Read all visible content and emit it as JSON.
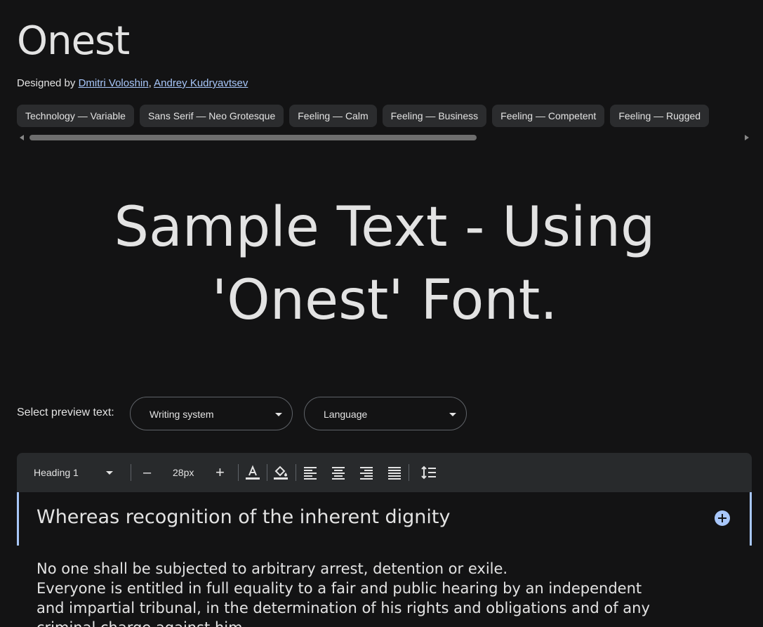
{
  "font": {
    "name": "Onest",
    "designed_by_label": "Designed by",
    "designers": [
      "Dmitri Voloshin",
      "Andrey Kudryavtsev"
    ],
    "separator": ", "
  },
  "tags": [
    "Technology — Variable",
    "Sans Serif — Neo Grotesque",
    "Feeling — Calm",
    "Feeling — Business",
    "Feeling — Competent",
    "Feeling — Rugged"
  ],
  "sample": {
    "line1": "Sample Text - Using",
    "line2": "'Onest' Font."
  },
  "preview": {
    "label": "Select preview text:",
    "writing_system": "Writing system",
    "language": "Language"
  },
  "toolbar": {
    "style": "Heading 1",
    "size": "28px",
    "minus": "–",
    "plus": "+"
  },
  "editor": {
    "heading": "Whereas recognition of the inherent dignity",
    "paragraphs": [
      "No one shall be subjected to arbitrary arrest, detention or exile.",
      "Everyone is entitled in full equality to a fair and public hearing by an independent and impartial tribunal, in the determination of his rights and obligations and of any criminal charge against him."
    ]
  },
  "colors": {
    "background": "#131314",
    "surface": "#282a2c",
    "accent": "#a8c7fa",
    "text": "#e3e3e3"
  }
}
